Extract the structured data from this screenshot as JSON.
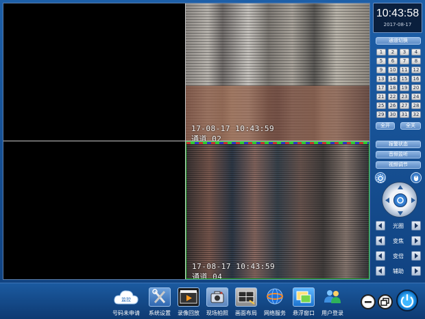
{
  "clock": {
    "time": "10:43:58",
    "date": "2017-08-17"
  },
  "panel": {
    "channel_switch": "通道切换",
    "channels": [
      "1",
      "2",
      "3",
      "4",
      "5",
      "6",
      "7",
      "8",
      "9",
      "10",
      "11",
      "12",
      "13",
      "14",
      "15",
      "16",
      "17",
      "18",
      "19",
      "20",
      "21",
      "22",
      "23",
      "24",
      "25",
      "26",
      "27",
      "28",
      "29",
      "30",
      "31",
      "32"
    ],
    "open_all": "全开",
    "close_all": "全关",
    "alarm_status": "报警状态",
    "audio_monitor": "音频监听",
    "video_adjust": "视频调节"
  },
  "ptz": {
    "iris": "光圈",
    "focus": "变焦",
    "zoom": "变倍",
    "aux": "辅助"
  },
  "video": {
    "ch2_timestamp": "17-08-17 10:43:59",
    "ch2_name": "通道 02",
    "ch4_timestamp": "17-08-17 10:43:59",
    "ch4_name": "通道 04"
  },
  "toolbar": {
    "cloud_badge": "监控",
    "items": [
      {
        "label": "号码未申请",
        "icon": "cloud-icon"
      },
      {
        "label": "系统设置",
        "icon": "tools-icon"
      },
      {
        "label": "录像回放",
        "icon": "film-icon"
      },
      {
        "label": "现场拍照",
        "icon": "camera-icon"
      },
      {
        "label": "画面布局",
        "icon": "layout-icon"
      },
      {
        "label": "网络服务",
        "icon": "network-icon"
      },
      {
        "label": "悬浮窗口",
        "icon": "window-icon"
      },
      {
        "label": "用户登录",
        "icon": "user-icon"
      }
    ]
  }
}
